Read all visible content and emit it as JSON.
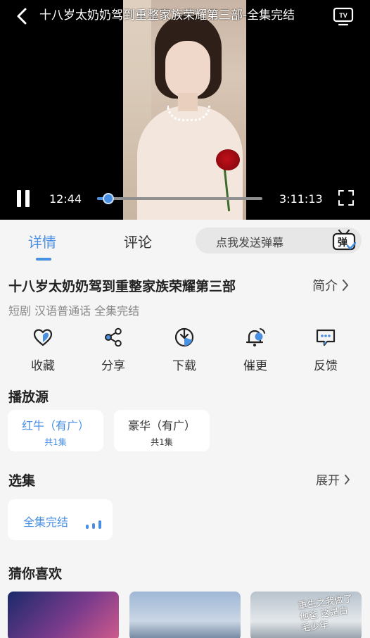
{
  "player": {
    "title": "十八岁太奶奶驾到重整家族荣耀第三部-全集完结",
    "current_time": "12:44",
    "total_time": "3:11:13",
    "progress_fraction": 0.066,
    "tv_icon": "tv-cast-icon",
    "accent_color": "#4a90e2"
  },
  "tabs": [
    {
      "label": "详情",
      "active": true
    },
    {
      "label": "评论",
      "active": false
    }
  ],
  "danmaku": {
    "placeholder": "点我发送弹幕",
    "badge": "弹"
  },
  "show": {
    "title": "十八岁太奶奶驾到重整家族荣耀第三部",
    "intro_label": "简介",
    "meta": "短剧 汉语普通话 全集完结"
  },
  "actions": [
    {
      "label": "收藏",
      "icon": "heart-icon"
    },
    {
      "label": "分享",
      "icon": "share-icon"
    },
    {
      "label": "下载",
      "icon": "download-icon"
    },
    {
      "label": "催更",
      "icon": "bell-icon"
    },
    {
      "label": "反馈",
      "icon": "feedback-icon"
    }
  ],
  "sources": {
    "heading": "播放源",
    "items": [
      {
        "name": "红牛（有广）",
        "count": "共1集",
        "active": true
      },
      {
        "name": "豪华（有广）",
        "count": "共1集",
        "active": false
      }
    ]
  },
  "episodes": {
    "heading": "选集",
    "expand_label": "展开",
    "current": "全集完结"
  },
  "recommend": {
    "heading": "猜你喜欢",
    "poster_3_caption": "重生之我做了他爸 这是白毛少年"
  }
}
